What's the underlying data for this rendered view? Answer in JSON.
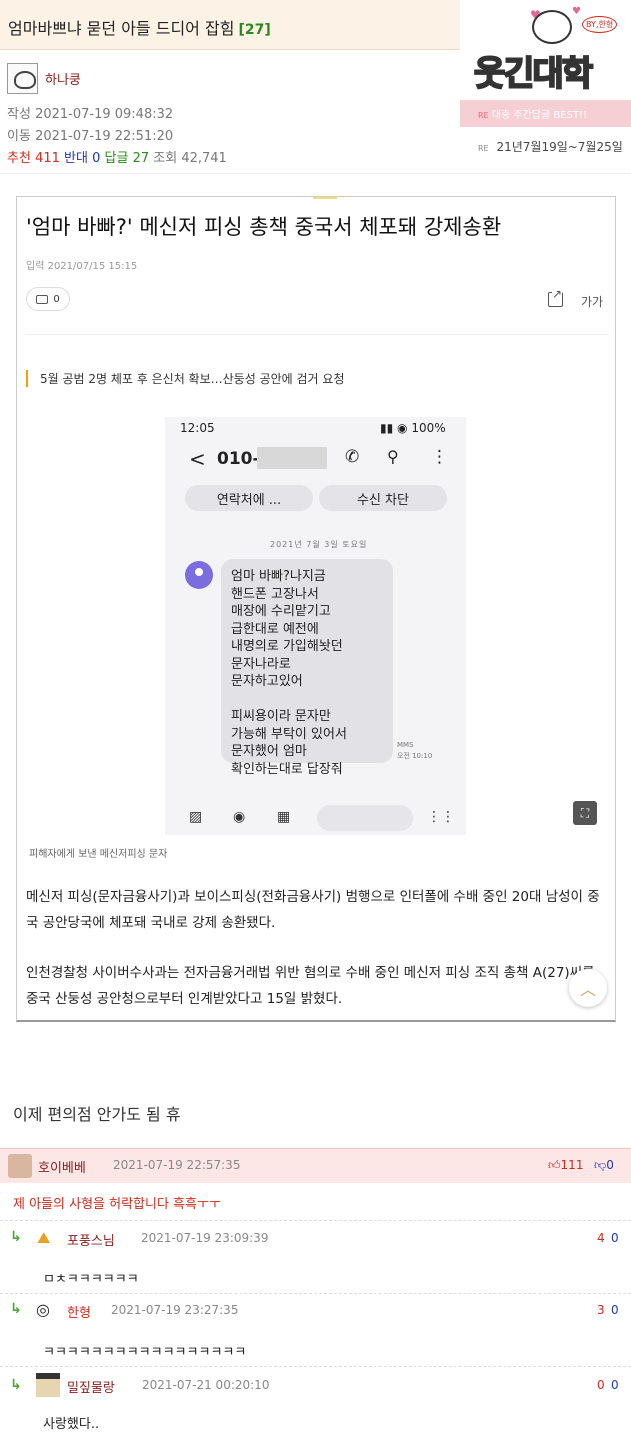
{
  "header": {
    "title": "엄마바쁘냐 묻던 아들 드디어 잡힘",
    "comment_count": "[27]"
  },
  "author": {
    "name": "하나쿵"
  },
  "meta": {
    "written_label": "작성",
    "written": "2021-07-19 09:48:32",
    "moved_label": "이동",
    "moved": "2021-07-19 22:51:20",
    "rec_label": "추천",
    "rec": "411",
    "opp_label": "반대",
    "opp": "0",
    "reply_label": "답글",
    "reply": "27",
    "view_label": "조회",
    "view": "42,741"
  },
  "side": {
    "logo": "웃긴대학",
    "badge": "BY,한형",
    "best_re": "RE",
    "best": "대충 주간답글 BEST!!",
    "range_re": "RE",
    "range": "21년7월19일~7월25일"
  },
  "article": {
    "title": "'엄마 바빠?' 메신저 피싱 총책 중국서 체포돼 강제송환",
    "date": "입력 2021/07/15 15:15",
    "comments": "0",
    "font_label": "가가",
    "subtitle": "5월 공범 2명 체포 후 은신처 확보…산둥성 공안에 검거 요청",
    "caption": "피해자에게 보낸 메신저피싱 문자",
    "p1": "메신저 피싱(문자금융사기)과 보이스피싱(전화금융사기) 범행으로 인터폴에 수배 중인 20대 남성이 중국 공안당국에 체포돼 국내로 강제 송환됐다.",
    "p2": "인천경찰청 사이버수사과는 전자금융거래법 위반 혐의로 수배 중인 메신저 피싱 조직 총책 A(27)씨를 중국 산둥성 공안청으로부터 인계받았다고 15일 밝혔다."
  },
  "phone": {
    "time": "12:05",
    "battery": "100%",
    "number": "010-",
    "btn1": "연락처에 ...",
    "btn2": "수신 차단",
    "date_line": "2021년 7월 3일 토요일",
    "message": "엄마 바빠?나지금\n핸드폰 고장나서\n매장에 수리맡기고\n급한대로 예전에\n내명의로 가입해놧던\n문자나라로\n문자하고있어\n\n피씨용이라 문자만\n가능해 부탁이 있어서\n문자했어 엄마\n확인하는대로 답장줘",
    "mms": "MMS",
    "mms_time": "오전 10:10"
  },
  "post_line": "이제 편의점 안가도 됨 휴",
  "comments": [
    {
      "nick": "호이베베",
      "date": "2021-07-19 22:57:35",
      "up": "111",
      "down": "0",
      "text": "제 아들의 사형을 허락합니다 흑흑ㅜㅜ"
    },
    {
      "nick": "포풍스님",
      "date": "2021-07-19 23:09:39",
      "up": "4",
      "down": "0",
      "text": "ㅁㅊㅋㅋㅋㅋㅋㅋ"
    },
    {
      "nick": "한형",
      "date": "2021-07-19 23:27:35",
      "up": "3",
      "down": "0",
      "text": "ㅋㅋㅋㅋㅋㅋㅋㅋㅋㅋㅋㅋㅋㅋㅋㅋㅋ"
    },
    {
      "nick": "밀짚물랑",
      "date": "2021-07-21 00:20:10",
      "up": "0",
      "down": "0",
      "text": "사랑했다.."
    }
  ],
  "colors": {
    "accent_red": "#d3281a",
    "accent_blue": "#1e3ab8",
    "accent_green": "#2b8a1c",
    "header_bg": "#fdf2e6",
    "best_comment_bg": "#fde6e6"
  }
}
